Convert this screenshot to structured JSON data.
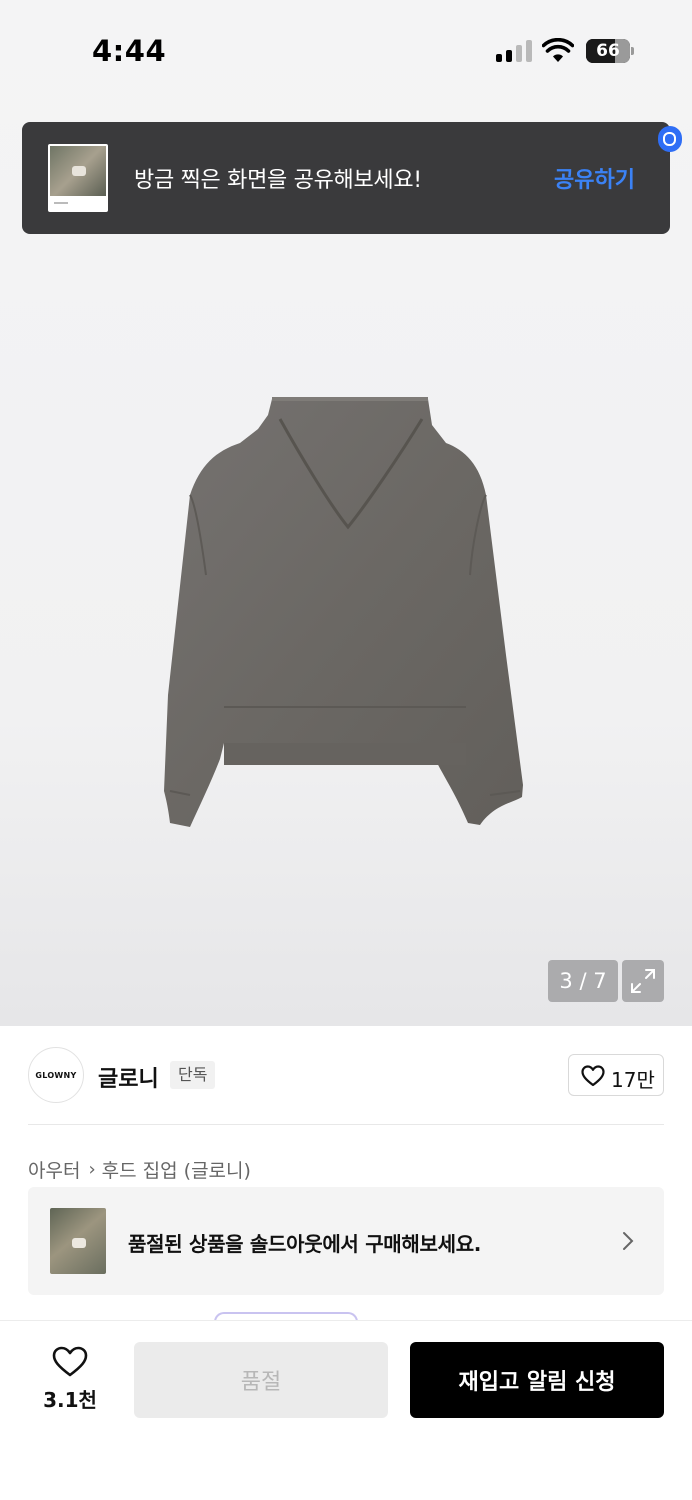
{
  "status_bar": {
    "time": "4:44",
    "battery": "66",
    "battery_level": 0.66,
    "icons": [
      "cellular-signal-icon",
      "wifi-icon",
      "battery-icon"
    ]
  },
  "toast": {
    "message": "방금 찍은 화면을 공유해보세요!",
    "action": "공유하기",
    "action_color": "#3b82f6"
  },
  "gallery": {
    "counter": "3 / 7",
    "product_color": "#6d6a66",
    "expand_icon": "expand-icon"
  },
  "brand": {
    "logo_text": "GLOWNY",
    "name": "글로니",
    "badge": "단독",
    "like_count": "17만"
  },
  "breadcrumb": {
    "category": "아우터",
    "subcategory": "후드 집업 (글로니)"
  },
  "soldout_banner": {
    "text": "품절된 상품을 솔드아웃에서 구매해보세요."
  },
  "bottom_bar": {
    "wish_count": "3.1천",
    "soldout_label": "품절",
    "restock_label": "재입고 알림 신청"
  }
}
